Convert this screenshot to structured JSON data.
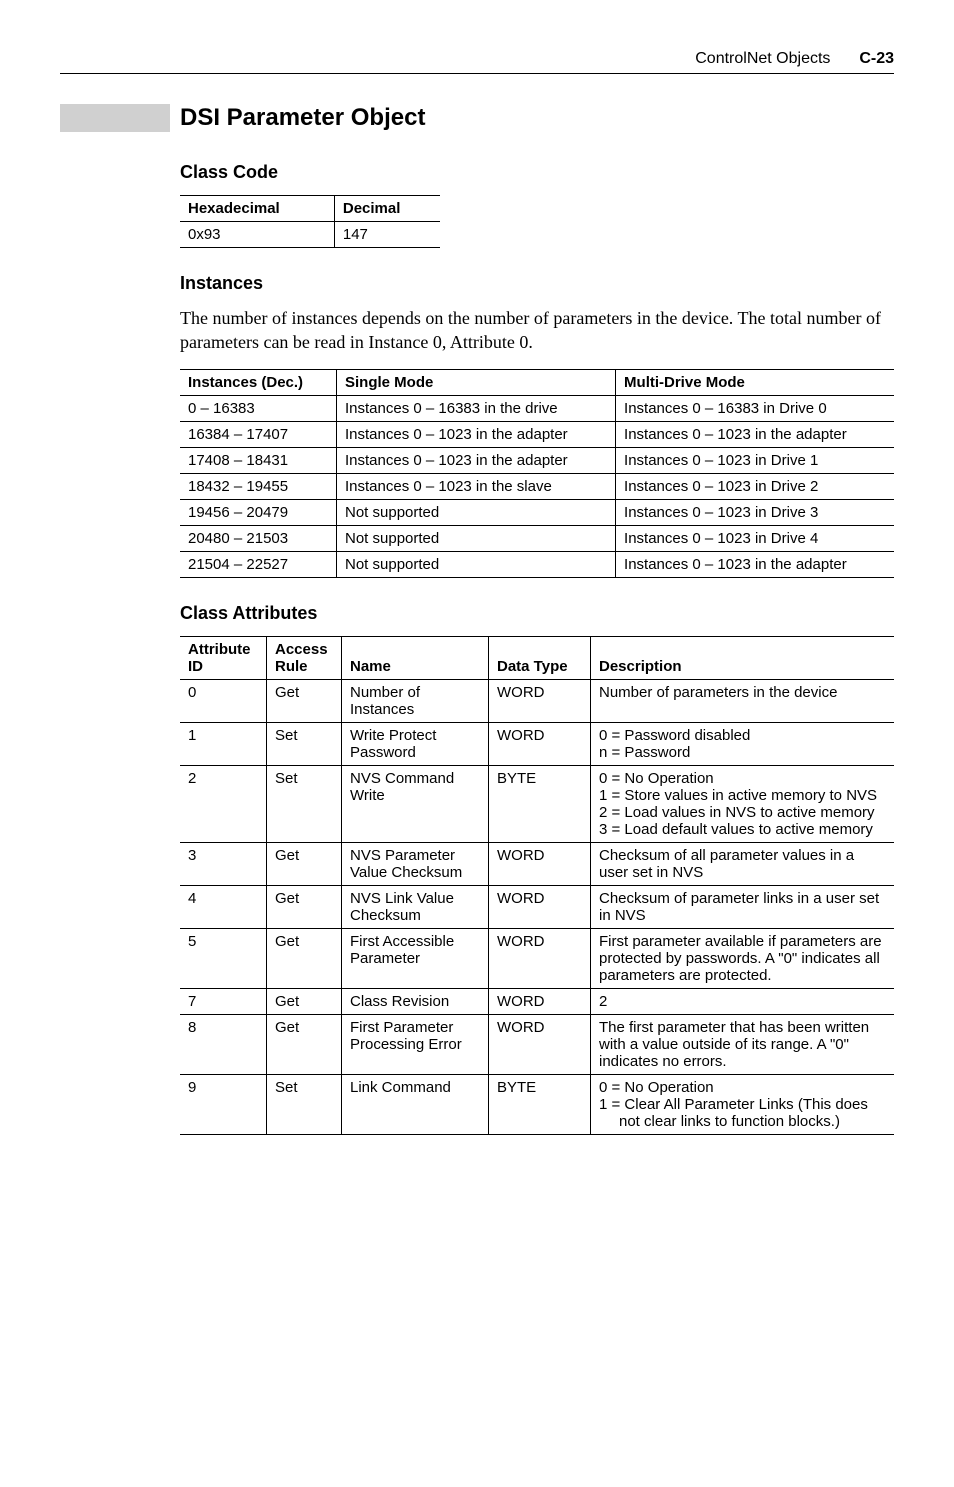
{
  "header": {
    "title": "ControlNet Objects",
    "page": "C-23"
  },
  "section_title": "DSI Parameter Object",
  "class_code": {
    "heading": "Class Code",
    "headers": [
      "Hexadecimal",
      "Decimal"
    ],
    "row": [
      "0x93",
      "147"
    ]
  },
  "instances": {
    "heading": "Instances",
    "body": "The number of instances depends on the number of parameters in the device. The total number of parameters can be read in Instance 0, Attribute 0.",
    "headers": [
      "Instances (Dec.)",
      "Single Mode",
      "Multi-Drive Mode"
    ],
    "rows": [
      [
        "0 – 16383",
        "Instances 0 – 16383 in the drive",
        "Instances 0 – 16383 in Drive 0"
      ],
      [
        "16384 – 17407",
        "Instances 0 – 1023 in the adapter",
        "Instances 0 – 1023 in the adapter"
      ],
      [
        "17408 – 18431",
        "Instances 0 – 1023 in the adapter",
        "Instances 0 – 1023 in Drive 1"
      ],
      [
        "18432 – 19455",
        "Instances 0 – 1023 in the slave",
        "Instances 0 – 1023 in Drive 2"
      ],
      [
        "19456 – 20479",
        "Not supported",
        "Instances 0 – 1023 in Drive 3"
      ],
      [
        "20480 – 21503",
        "Not supported",
        "Instances 0 – 1023 in Drive 4"
      ],
      [
        "21504 – 22527",
        "Not supported",
        "Instances 0 – 1023 in the adapter"
      ]
    ]
  },
  "class_attributes": {
    "heading": "Class Attributes",
    "headers": [
      "Attribute\nID",
      "Access\nRule",
      "Name",
      "Data Type",
      "Description"
    ],
    "rows": [
      {
        "id": "0",
        "rule": "Get",
        "name": "Number of Instances",
        "type": "WORD",
        "desc": "Number of parameters in the device"
      },
      {
        "id": "1",
        "rule": "Set",
        "name": "Write Protect Password",
        "type": "WORD",
        "desc": "0 = Password disabled\nn = Password"
      },
      {
        "id": "2",
        "rule": "Set",
        "name": "NVS Command Write",
        "type": "BYTE",
        "desc": "0 = No Operation\n1 = Store values in active memory to NVS\n2 = Load values in NVS to active memory\n3 = Load default values to active memory"
      },
      {
        "id": "3",
        "rule": "Get",
        "name": "NVS Parameter Value Checksum",
        "type": "WORD",
        "desc": "Checksum of all parameter values in a user set in NVS"
      },
      {
        "id": "4",
        "rule": "Get",
        "name": "NVS Link Value Checksum",
        "type": "WORD",
        "desc": "Checksum of parameter links in a user set in NVS"
      },
      {
        "id": "5",
        "rule": "Get",
        "name": "First Accessible Parameter",
        "type": "WORD",
        "desc": "First parameter available if parameters are protected by passwords. A \"0\" indicates all parameters are protected."
      },
      {
        "id": "7",
        "rule": "Get",
        "name": "Class Revision",
        "type": "WORD",
        "desc": "2"
      },
      {
        "id": "8",
        "rule": "Get",
        "name": "First Parameter Processing Error",
        "type": "WORD",
        "desc": "The first parameter that has been written with a value outside of its range. A \"0\" indicates no errors."
      },
      {
        "id": "9",
        "rule": "Set",
        "name": "Link Command",
        "type": "BYTE",
        "desc": "0 = No Operation\n1 = Clear All Parameter Links (This does",
        "desc_indent": "not clear links to function blocks.)"
      }
    ]
  }
}
